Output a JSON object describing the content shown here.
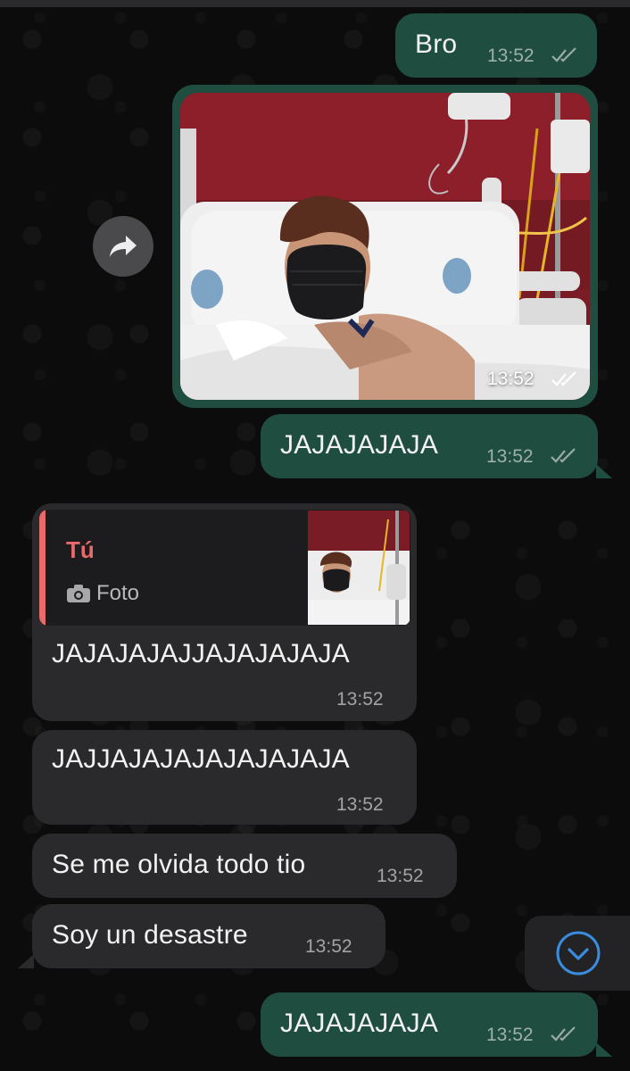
{
  "colors": {
    "outgoing_bubble": "#1f4d3f",
    "incoming_bubble": "#2a2a2c",
    "reply_accent": "#e86a6a",
    "scroll_button_accent": "#3a8dde"
  },
  "messages": [
    {
      "direction": "out",
      "text": "Bro",
      "time": "13:52",
      "status_icon": "double-check-icon"
    },
    {
      "direction": "out",
      "type": "photo",
      "time": "13:52",
      "status_icon": "double-check-icon"
    },
    {
      "direction": "out",
      "text": "JAJAJAJAJA",
      "time": "13:52",
      "status_icon": "double-check-icon"
    },
    {
      "direction": "in",
      "text": "JAJAJAJAJJAJAJAJAJA",
      "time": "13:52",
      "reply": {
        "author": "Tú",
        "label": "Foto",
        "icon": "camera-icon"
      }
    },
    {
      "direction": "in",
      "text": "JAJJAJAJAJAJAJAJAJA",
      "time": "13:52"
    },
    {
      "direction": "in",
      "text": "Se me olvida todo tio",
      "time": "13:52"
    },
    {
      "direction": "in",
      "text": "Soy un desastre",
      "time": "13:52"
    },
    {
      "direction": "out",
      "text": "JAJAJAJAJA",
      "time": "13:52",
      "status_icon": "double-check-icon"
    }
  ],
  "controls": {
    "forward_icon": "forward-arrow-icon",
    "scroll_down_icon": "chevron-down-icon"
  }
}
